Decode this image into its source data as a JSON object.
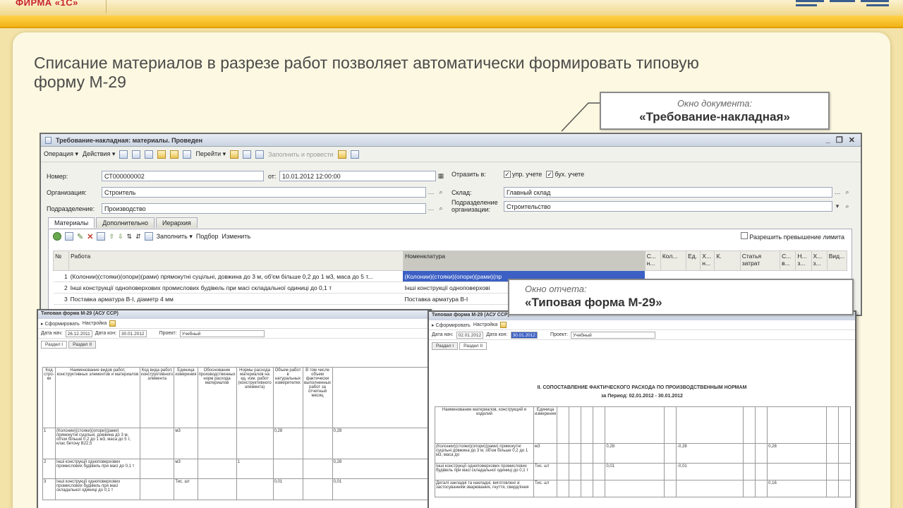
{
  "brand": "ФИРМА «1С»",
  "headline": "Списание материалов в разрезе работ позволяет автоматически формировать типовую форму М-29",
  "callout_doc": {
    "small": "Окно документа:",
    "big": "«Требование-накладная»"
  },
  "callout_report": {
    "small": "Окно отчета:",
    "big": "«Типовая форма М-29»"
  },
  "doc_window": {
    "title": "Требование-накладная: материалы. Проведен",
    "toolbar": {
      "operation": "Операция",
      "actions": "Действия",
      "goto": "Перейти",
      "fill_post": "Заполнить и провести"
    },
    "fields": {
      "number_label": "Номер:",
      "number_value": "СТ000000002",
      "date_label": "от:",
      "date_value": "10.01.2012 12:00:00",
      "org_label": "Организация:",
      "org_value": "Строитель",
      "dept_label": "Подразделение:",
      "dept_value": "Производство",
      "reflect_label": "Отразить в:",
      "mgmt": "упр. учете",
      "acct": "бух. учете",
      "warehouse_label": "Склад:",
      "warehouse_value": "Главный склад",
      "org_dept_label": "Подразделение организации:",
      "org_dept_value": "Строительство"
    },
    "tabs": [
      "Материалы",
      "Дополнительно",
      "Иерархия"
    ],
    "tab_toolbar": {
      "fill": "Заполнить",
      "pick": "Подбор",
      "change": "Изменить",
      "allow_exceed": "Разрешить превышение лимита"
    },
    "grid_headers": [
      "№",
      "Работа",
      "Номенклатура",
      "С... н...",
      "Кол...",
      "Ед.",
      "Х... н...",
      "К.",
      "Статья затрат",
      "С... в...",
      "Н... з...",
      "Х... з...",
      "Вид..."
    ],
    "rows": [
      {
        "n": "1",
        "work": "(Колонии)(стояки)(опори)(рами) прямокутні суцільні, довжина до 3 м, об'єм більше 0,2 до 1 м3, маса до 5 т...",
        "item": "(Колонии)(стояки)(опори)(рами)(пр"
      },
      {
        "n": "2",
        "work": "Інші конструкції одноповерхових промислових будівель при масі складальної одиниці до 0,1 т",
        "item": "Інші конструкції одноповерхові"
      },
      {
        "n": "3",
        "work": "Поставка арматура В-І, діаметр 4 мм",
        "item": "Поставка арматура В-І"
      }
    ]
  },
  "report1": {
    "title": "Типовая форма М-29 (АСУ ССР)",
    "toolbar": "Сформировать",
    "settings": "Настройка",
    "date_from_label": "Дата нач:",
    "date_from": "26.12.2011",
    "date_to_label": "Дата кон:",
    "date_to": "30.01.2012",
    "object_label": "Проект:",
    "object": "Учебный",
    "tabs": [
      "Раздел I",
      "Раздел II"
    ],
    "col_headers": [
      "Код стро-ки",
      "Наименование видов работ, конструктивных элементов и материалов",
      "Код вида работ, конструктивного элемента",
      "Единица измерения",
      "Обоснование производственных норм расхода материалов",
      "Нормы расхода материалов на ед. изм. работ (конструктивного элемента)",
      "Объем работ в натуральных измерителях",
      "В том числе объем фактически выполненных работ за отчетный месяц"
    ],
    "rows": [
      {
        "n": "1",
        "name": "(Колонии)(стояки)(опори)(рами) прямокутні суцільні, довжина до 3 м, об'єм більше 0,2 до 1 м3, маса до 5 т, клас бетону В22,5",
        "unit": "м3",
        "norm": "0,28",
        "fact": "0,28"
      },
      {
        "n": "2",
        "name": "Інші конструкції одноповерхових промислових будівель при масі до 0,1 т",
        "unit": "м3",
        "norm": "1",
        "fact": "0,28"
      },
      {
        "n": "3",
        "name": "Інші конструкції одноповерхових промислових будівель при масі складальної одиниці до 0,1 т",
        "unit": "Тис. шт",
        "norm": "0,01",
        "fact": "0,01"
      }
    ]
  },
  "report2": {
    "title": "Типовая форма М-29 (АСУ ССР)",
    "toolbar": "Сформировать",
    "settings": "Настройка",
    "date_from_label": "Дата нач:",
    "date_from": "02.01.2012",
    "date_to_label": "Дата кон:",
    "date_to": "30.01.2012",
    "object_label": "Проект:",
    "object": "Учебный",
    "tabs": [
      "Раздел I",
      "Раздел II"
    ],
    "heading": "II. СОПОСТАВЛЕНИЕ ФАКТИЧЕСКОГО РАСХОДА ПО ПРОИЗВОДСТВЕННЫМ НОРМАМ",
    "period": "за Период: 02.01.2012 - 30.01.2012",
    "first_col": "Наименование материалов, конструкций и изделий",
    "unit_col": "Единица измерения",
    "rows": [
      {
        "name": "(Колонии)(стояки)(опори)(рами) прямокутні суцільні довжина до 3 м, об'єм більше 0,2 до 1 м3, маса до",
        "unit": "м3",
        "v1": "0,28",
        "v2": "-0,28",
        "v3": "0,28"
      },
      {
        "name": "Інші конструкції одноповерхових промислових будівель при масі складальної одиниці до 0,1 т",
        "unit": "Тис. шт",
        "v1": "0,01",
        "v2": "-0,01",
        "v3": ""
      },
      {
        "name": "Деталі закладні та накладні, виготовлені зі застосуванням зварювання, гнуття, свердління",
        "unit": "Тис. шт",
        "v1": "",
        "v2": "",
        "v3": "0,16"
      }
    ]
  }
}
